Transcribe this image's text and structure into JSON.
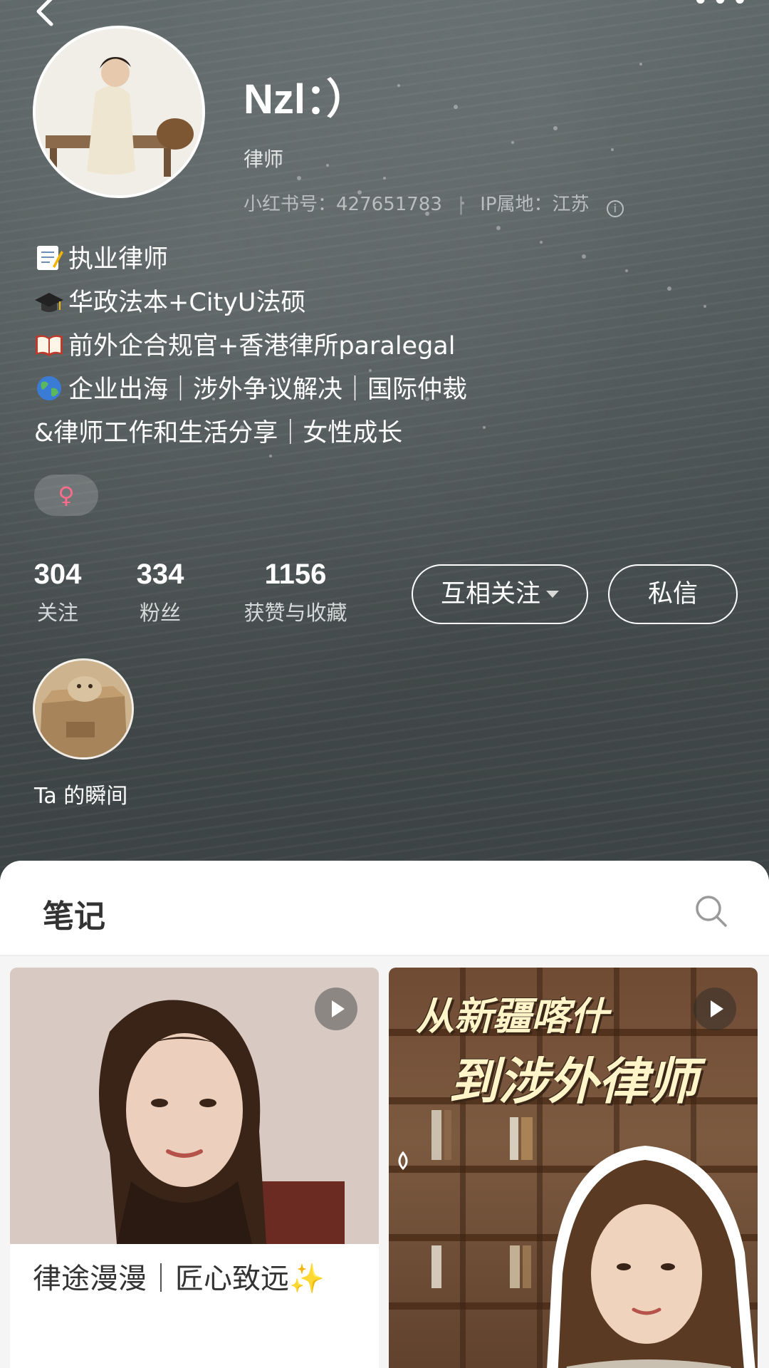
{
  "profile": {
    "nickname": "Nzl：）",
    "job": "律师",
    "id_label": "小红书号：427651783",
    "ip_label": "IP属地：江苏",
    "bio": [
      {
        "icon": "memo-emoji",
        "text": "执业律师"
      },
      {
        "icon": "graduation-cap-emoji",
        "text": "华政法本+CityU法硕"
      },
      {
        "icon": "open-book-emoji",
        "text": "前外企合规官+香港律所paralegal"
      },
      {
        "icon": "globe-emoji",
        "text": "企业出海｜涉外争议解决｜国际仲裁"
      },
      {
        "icon": "",
        "text": "&律师工作和生活分享｜女性成长"
      }
    ],
    "gender_symbol": "♀"
  },
  "stats": {
    "following": {
      "value": "304",
      "label": "关注"
    },
    "followers": {
      "value": "334",
      "label": "粉丝"
    },
    "likes": {
      "value": "1156",
      "label": "获赞与收藏"
    }
  },
  "actions": {
    "mutual_follow": "互相关注",
    "message": "私信"
  },
  "moments": {
    "label": "Ta 的瞬间"
  },
  "notes": {
    "tab_title": "笔记",
    "cards": [
      {
        "title": "律途漫漫｜匠心致远✨",
        "has_video": true
      },
      {
        "cover_text_line1": "从新疆喀什",
        "cover_text_line2": "到涉外律师",
        "has_video": true
      }
    ]
  },
  "colors": {
    "header_bg": "#414849",
    "gender_pink": "#ff6b8a",
    "text_primary": "#333333"
  }
}
